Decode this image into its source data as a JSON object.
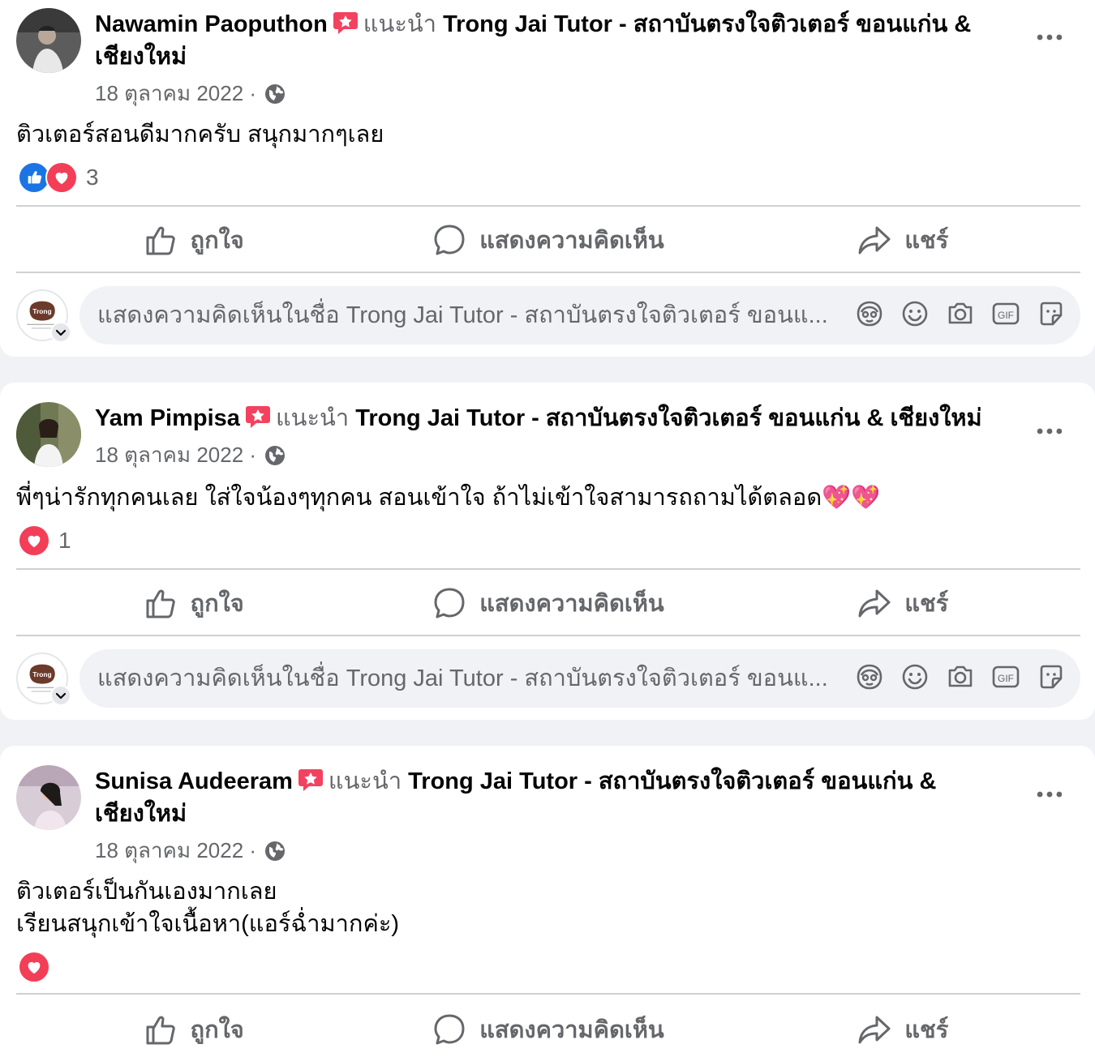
{
  "posts": [
    {
      "author": "Nawamin Paoputhon",
      "recommends_label": "แนะนำ",
      "page_name": "Trong Jai Tutor - สถาบันตรงใจติวเตอร์ ขอนแก่น & เชียงใหม่",
      "date": "18 ตุลาคม 2022 ·",
      "text": "ติวเตอร์สอนดีมากครับ สนุกมากๆเลย",
      "reaction_count": "3",
      "reactions": [
        "like",
        "love"
      ]
    },
    {
      "author": "Yam Pimpisa",
      "recommends_label": "แนะนำ",
      "page_name": "Trong Jai Tutor - สถาบันตรงใจติวเตอร์ ขอนแก่น & เชียงใหม่",
      "date": "18 ตุลาคม 2022 ·",
      "text": "พี่ๆน่ารักทุกคนเลย ใส่ใจน้องๆทุกคน สอนเข้าใจ ถ้าไม่เข้าใจสามารถถามได้ตลอด💖💖",
      "reaction_count": "1",
      "reactions": [
        "love"
      ]
    },
    {
      "author": "Sunisa Audeeram",
      "recommends_label": "แนะนำ",
      "page_name": "Trong Jai Tutor - สถาบันตรงใจติวเตอร์ ขอนแก่น & เชียงใหม่",
      "date": "18 ตุลาคม 2022 ·",
      "text": "ติวเตอร์เป็นกันเองมากเลย\nเรียนสนุกเข้าใจเนื้อหา(แอร์ฉ่ำมากค่ะ)",
      "reaction_count": "",
      "reactions": [
        "love"
      ]
    }
  ],
  "actions": {
    "like": "ถูกใจ",
    "comment": "แสดงความคิดเห็น",
    "share": "แชร์"
  },
  "comment_placeholder": "แสดงความคิดเห็นในชื่อ Trong Jai Tutor - สถาบันตรงใจติวเตอร์ ขอนแ...",
  "colors": {
    "like_blue": "#1b74e4",
    "love_red": "#f33e58",
    "secondary_text": "#65676b",
    "badge_pink": "#f3425f"
  },
  "icons": [
    "recommend-badge-icon",
    "globe-icon",
    "more-options-icon",
    "like-icon",
    "comment-icon",
    "share-icon",
    "avatar-sticker-icon",
    "emoji-icon",
    "camera-icon",
    "gif-icon",
    "sticker-icon"
  ]
}
